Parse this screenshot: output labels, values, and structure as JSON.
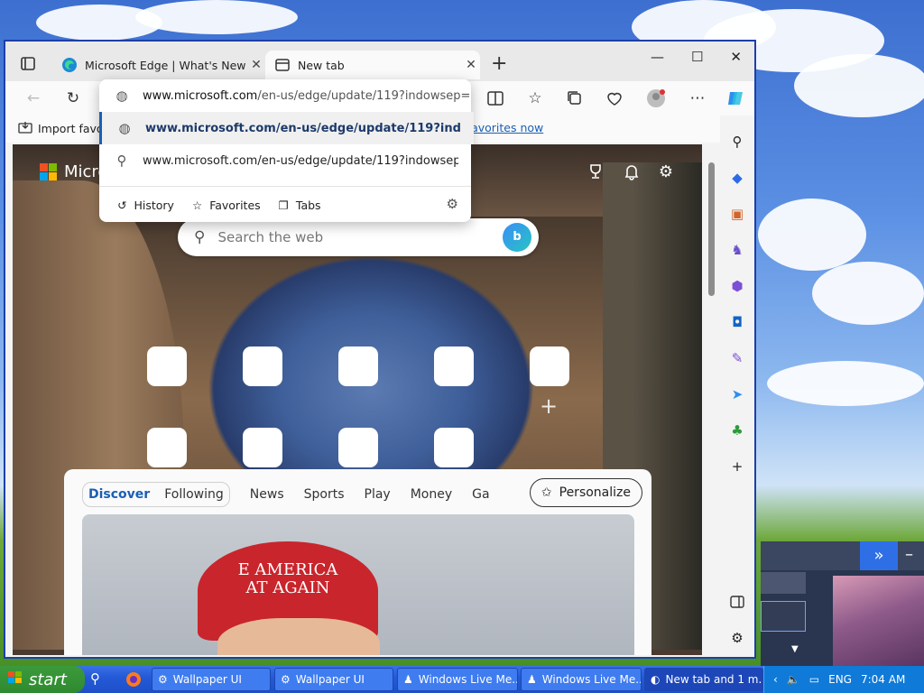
{
  "browser": {
    "tabs": [
      {
        "title": "Microsoft Edge | What's New",
        "active": false
      },
      {
        "title": "New tab",
        "active": true
      }
    ],
    "new_tab_glyph": "+",
    "window_controls": {
      "minimize": "—",
      "maximize": "☐",
      "close": "✕"
    }
  },
  "toolbar": {
    "back_icon": "←",
    "refresh_icon": "↻"
  },
  "address_dropdown": {
    "input_host": "www.microsoft.com",
    "input_path": "/en-us/edge/update/119?indowsep=",
    "suggestions": [
      "www.microsoft.com/en-us/edge/update/119?indo...",
      "www.microsoft.com/en-us/edge/update/119?indowsep..."
    ],
    "footer": {
      "history": "History",
      "favorites": "Favorites",
      "tabs": "Tabs"
    }
  },
  "favorites_bar": {
    "import_label": "Import favo",
    "now_link": "e favorites now"
  },
  "page": {
    "logo_text": "Micro",
    "search_placeholder": "Search the web",
    "bing_letter": "b",
    "add_tile_glyph": "+",
    "feed_tabs": {
      "discover": "Discover",
      "following": "Following"
    },
    "feed_nav": [
      "News",
      "Sports",
      "Play",
      "Money",
      "Ga"
    ],
    "personalize_label": "Personalize",
    "image_cap_text": "E AMERICA\nAT AGAIN"
  },
  "taskbar": {
    "start_label": "start",
    "items": [
      "Wallpaper UI",
      "Wallpaper UI",
      "Windows Live Me...",
      "Windows Live Me...",
      "New tab and 1 m..."
    ],
    "language": "ENG",
    "clock": "7:04 AM"
  },
  "colors": {
    "accent": "#1a5fb4",
    "taskbar": "#245ad8",
    "start": "#2f8a2f"
  }
}
